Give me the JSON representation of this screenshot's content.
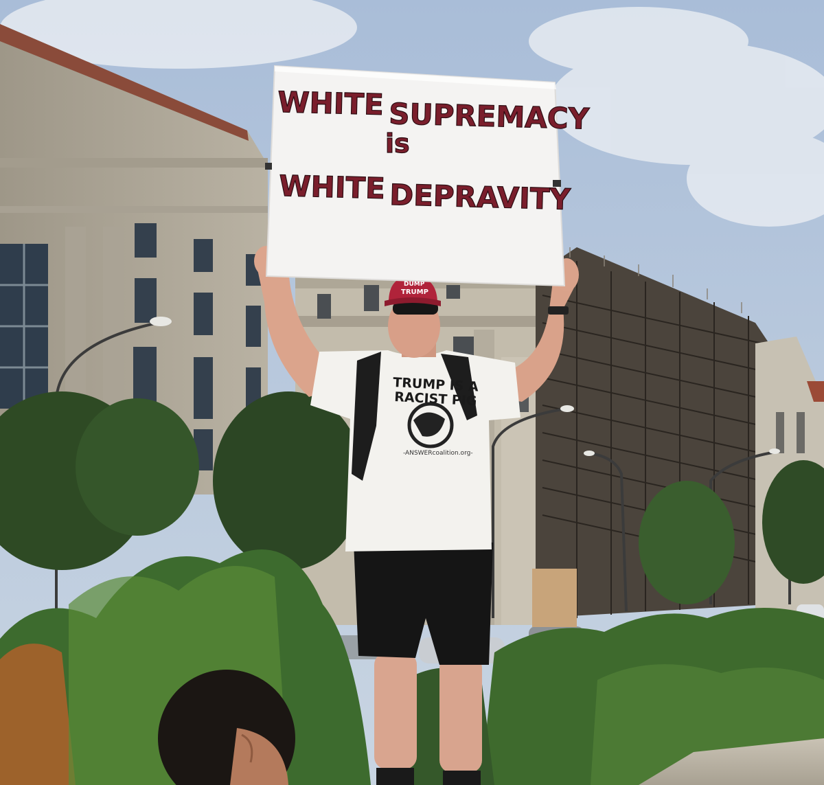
{
  "sign": {
    "line1a": "WHITE",
    "line1b": "SUPREMACY",
    "line2": "is",
    "line3a": "WHITE",
    "line3b": "DEPRAVITY"
  },
  "hat": {
    "line1": "DUMP",
    "line2": "TRUMP"
  },
  "shirt": {
    "line1": "TRUMP IS A",
    "line2": "RACIST PIG",
    "url": "-ANSWERcoalition.org-"
  },
  "colors": {
    "sky": "#8fa8c8",
    "sign_text": "#7a1e2c",
    "hat": "#b0233a",
    "building": "#b8b0a0",
    "scaffold": "#3b3630",
    "foliage": "#3d6b2e"
  }
}
